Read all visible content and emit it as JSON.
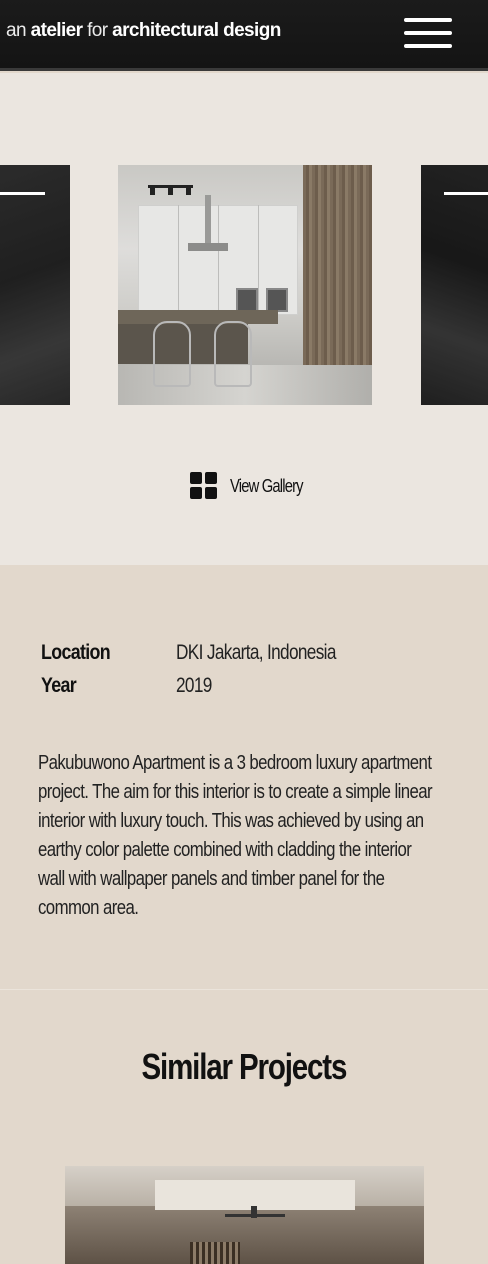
{
  "header": {
    "brand_prefix": "an",
    "brand_word1": "atelier",
    "brand_middle": "for",
    "brand_word2": "architectural design"
  },
  "gallery": {
    "view_label": "View Gallery"
  },
  "project": {
    "meta": [
      {
        "key": "Location",
        "value": "DKI Jakarta, Indonesia"
      },
      {
        "key": "Year",
        "value": "2019"
      }
    ],
    "description": "Pakubuwono Apartment is a 3 bedroom luxury apartment project. The aim for this interior is to create a simple linear interior with luxury touch. This was achieved by using an earthy color palette combined with cladding the interior wall with wallpaper panels and timber panel for the common area."
  },
  "similar": {
    "title": "Similar Projects"
  },
  "colors": {
    "header_bg": "#161616",
    "gallery_bg": "#ebe6e0",
    "info_bg": "#e2d8cc"
  }
}
